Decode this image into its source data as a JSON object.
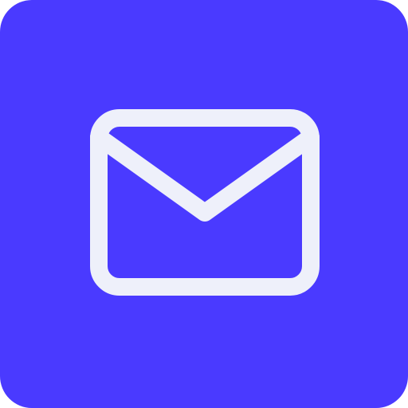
{
  "app_icon": {
    "icon": "mail-icon",
    "background_color": "#4a3aff",
    "glyph_color": "#eef0fa"
  }
}
